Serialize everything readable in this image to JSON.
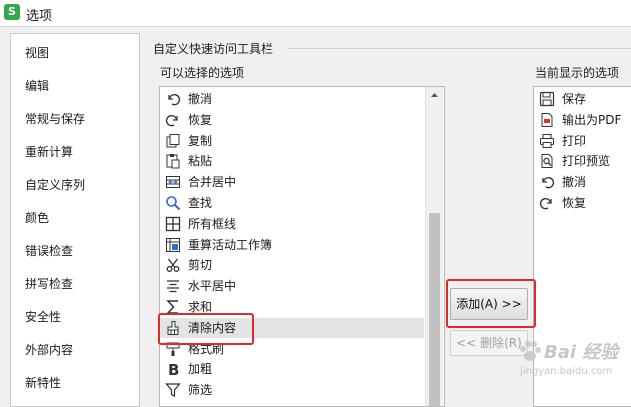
{
  "window": {
    "app_icon": "S",
    "title": "选项"
  },
  "nav": [
    "视图",
    "编辑",
    "常规与保存",
    "重新计算",
    "自定义序列",
    "颜色",
    "错误检查",
    "拼写检查",
    "安全性",
    "外部内容",
    "新特性"
  ],
  "group_title": "自定义快速访问工具栏",
  "available_label": "可以选择的选项",
  "current_label": "当前显示的选项",
  "available": [
    {
      "label": "撤消",
      "icon": "undo-icon"
    },
    {
      "label": "恢复",
      "icon": "redo-icon"
    },
    {
      "label": "复制",
      "icon": "copy-icon"
    },
    {
      "label": "粘贴",
      "icon": "paste-icon"
    },
    {
      "label": "合并居中",
      "icon": "merge-center-icon"
    },
    {
      "label": "查找",
      "icon": "search-icon"
    },
    {
      "label": "所有框线",
      "icon": "all-borders-icon"
    },
    {
      "label": "重算活动工作簿",
      "icon": "recalculate-icon"
    },
    {
      "label": "剪切",
      "icon": "cut-icon"
    },
    {
      "label": "水平居中",
      "icon": "align-center-icon"
    },
    {
      "label": "求和",
      "icon": "sum-icon"
    },
    {
      "label": "清除内容",
      "icon": "eraser-icon"
    },
    {
      "label": "格式刷",
      "icon": "format-painter-icon"
    },
    {
      "label": "加粗",
      "icon": "bold-icon"
    },
    {
      "label": "筛选",
      "icon": "filter-icon"
    }
  ],
  "selected_index": 11,
  "current": [
    {
      "label": "保存",
      "icon": "save-icon"
    },
    {
      "label": "输出为PDF",
      "icon": "pdf-icon"
    },
    {
      "label": "打印",
      "icon": "print-icon"
    },
    {
      "label": "打印预览",
      "icon": "print-preview-icon"
    },
    {
      "label": "撤消",
      "icon": "undo-icon"
    },
    {
      "label": "恢复",
      "icon": "redo-icon"
    }
  ],
  "buttons": {
    "add": "添加(A) >>",
    "remove": "<< 删除(R)"
  },
  "highlight_color": "#e02a2a",
  "watermark": {
    "main": "Bai 经验",
    "sub": "jingyan.baidu.com"
  }
}
